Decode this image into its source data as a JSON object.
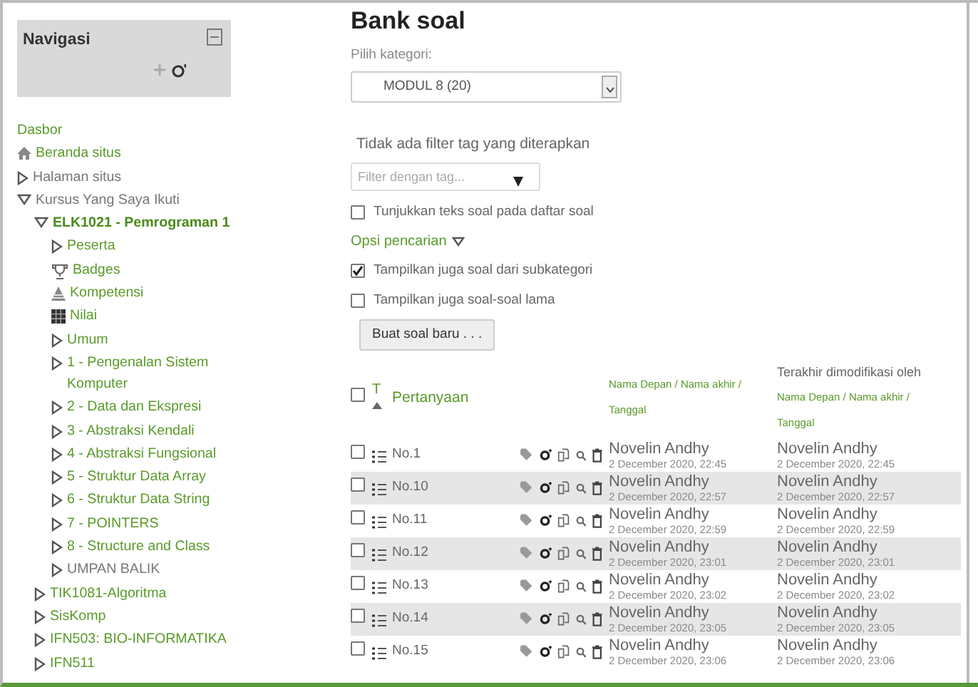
{
  "navigation": {
    "title": "Navigasi",
    "items": [
      {
        "label": "Dasbor",
        "kind": "plain",
        "link": true
      },
      {
        "label": "Beranda situs",
        "kind": "home",
        "link": true
      },
      {
        "label": "Halaman situs",
        "kind": "branch",
        "expanded": false,
        "link": false
      },
      {
        "label": "Kursus Yang Saya Ikuti",
        "kind": "branch",
        "expanded": true,
        "link": false,
        "children": [
          {
            "label": "ELK1021 - Pemrograman 1",
            "kind": "branch",
            "expanded": true,
            "link": true,
            "current": true,
            "children": [
              {
                "label": "Peserta",
                "kind": "branch",
                "expanded": false,
                "link": true
              },
              {
                "label": "Badges",
                "kind": "badges",
                "link": true
              },
              {
                "label": "Kompetensi",
                "kind": "competency",
                "link": true
              },
              {
                "label": "Nilai",
                "kind": "grades",
                "link": true
              },
              {
                "label": "Umum",
                "kind": "branch",
                "expanded": false,
                "link": true
              },
              {
                "label": "1 - Pengenalan Sistem Komputer",
                "kind": "branch",
                "expanded": false,
                "link": true
              },
              {
                "label": "2 - Data dan Ekspresi",
                "kind": "branch",
                "expanded": false,
                "link": true
              },
              {
                "label": "3 - Abstraksi Kendali",
                "kind": "branch",
                "expanded": false,
                "link": true
              },
              {
                "label": "4 - Abstraksi Fungsional",
                "kind": "branch",
                "expanded": false,
                "link": true
              },
              {
                "label": "5 - Struktur Data Array",
                "kind": "branch",
                "expanded": false,
                "link": true
              },
              {
                "label": "6 - Struktur Data String",
                "kind": "branch",
                "expanded": false,
                "link": true
              },
              {
                "label": "7 - POINTERS",
                "kind": "branch",
                "expanded": false,
                "link": true
              },
              {
                "label": "8 - Structure and Class",
                "kind": "branch",
                "expanded": false,
                "link": true
              },
              {
                "label": "UMPAN BALIK",
                "kind": "branch",
                "expanded": false,
                "link": false
              }
            ]
          },
          {
            "label": "TIK1081-Algoritma",
            "kind": "branch",
            "expanded": false,
            "link": true
          },
          {
            "label": "SisKomp",
            "kind": "branch",
            "expanded": false,
            "link": true
          },
          {
            "label": "IFN503: BIO-INFORMATIKA",
            "kind": "branch",
            "expanded": false,
            "link": true
          },
          {
            "label": "IFN511",
            "kind": "branch",
            "expanded": false,
            "link": true
          }
        ]
      }
    ]
  },
  "main": {
    "title": "Bank soal",
    "category_label": "Pilih kategori:",
    "category_value": "MODUL 8 (20)",
    "tag_filter_note": "Tidak ada filter tag yang diterapkan",
    "tag_filter": {
      "placeholder": "Filter dengan tag..."
    },
    "show_text_option": {
      "label": "Tunjukkan teks soal pada daftar soal",
      "checked": false
    },
    "search_options": {
      "label": "Opsi pencarian",
      "expanded": true
    },
    "options": [
      {
        "label": "Tampilkan juga soal dari subkategori",
        "checked": true
      },
      {
        "label": "Tampilkan juga soal-soal lama",
        "checked": false
      }
    ],
    "create_button": "Buat soal baru . . .",
    "table": {
      "select_all_checked": false,
      "type_header": "T",
      "question_header": "Pertanyaan",
      "created_header": {
        "sort_name": "Nama Depan / Nama akhir /",
        "sort_date": "Tanggal"
      },
      "modified_header": {
        "title": "Terakhir dimodifikasi oleh",
        "sort_name": "Nama Depan / Nama akhir /",
        "sort_date": "Tanggal"
      },
      "rows": [
        {
          "checked": false,
          "name": "No.1",
          "created_by": "Novelin Andhy",
          "created_at": "2 December 2020, 22:45",
          "modified_by": "Novelin Andhy",
          "modified_at": "2 December 2020, 22:45"
        },
        {
          "checked": false,
          "name": "No.10",
          "created_by": "Novelin Andhy",
          "created_at": "2 December 2020, 22:57",
          "modified_by": "Novelin Andhy",
          "modified_at": "2 December 2020, 22:57"
        },
        {
          "checked": false,
          "name": "No.11",
          "created_by": "Novelin Andhy",
          "created_at": "2 December 2020, 22:59",
          "modified_by": "Novelin Andhy",
          "modified_at": "2 December 2020, 22:59"
        },
        {
          "checked": false,
          "name": "No.12",
          "created_by": "Novelin Andhy",
          "created_at": "2 December 2020, 23:01",
          "modified_by": "Novelin Andhy",
          "modified_at": "2 December 2020, 23:01"
        },
        {
          "checked": false,
          "name": "No.13",
          "created_by": "Novelin Andhy",
          "created_at": "2 December 2020, 23:02",
          "modified_by": "Novelin Andhy",
          "modified_at": "2 December 2020, 23:02"
        },
        {
          "checked": false,
          "name": "No.14",
          "created_by": "Novelin Andhy",
          "created_at": "2 December 2020, 23:05",
          "modified_by": "Novelin Andhy",
          "modified_at": "2 December 2020, 23:05"
        },
        {
          "checked": false,
          "name": "No.15",
          "created_by": "Novelin Andhy",
          "created_at": "2 December 2020, 23:06",
          "modified_by": "Novelin Andhy",
          "modified_at": "2 December 2020, 23:06"
        }
      ]
    }
  }
}
